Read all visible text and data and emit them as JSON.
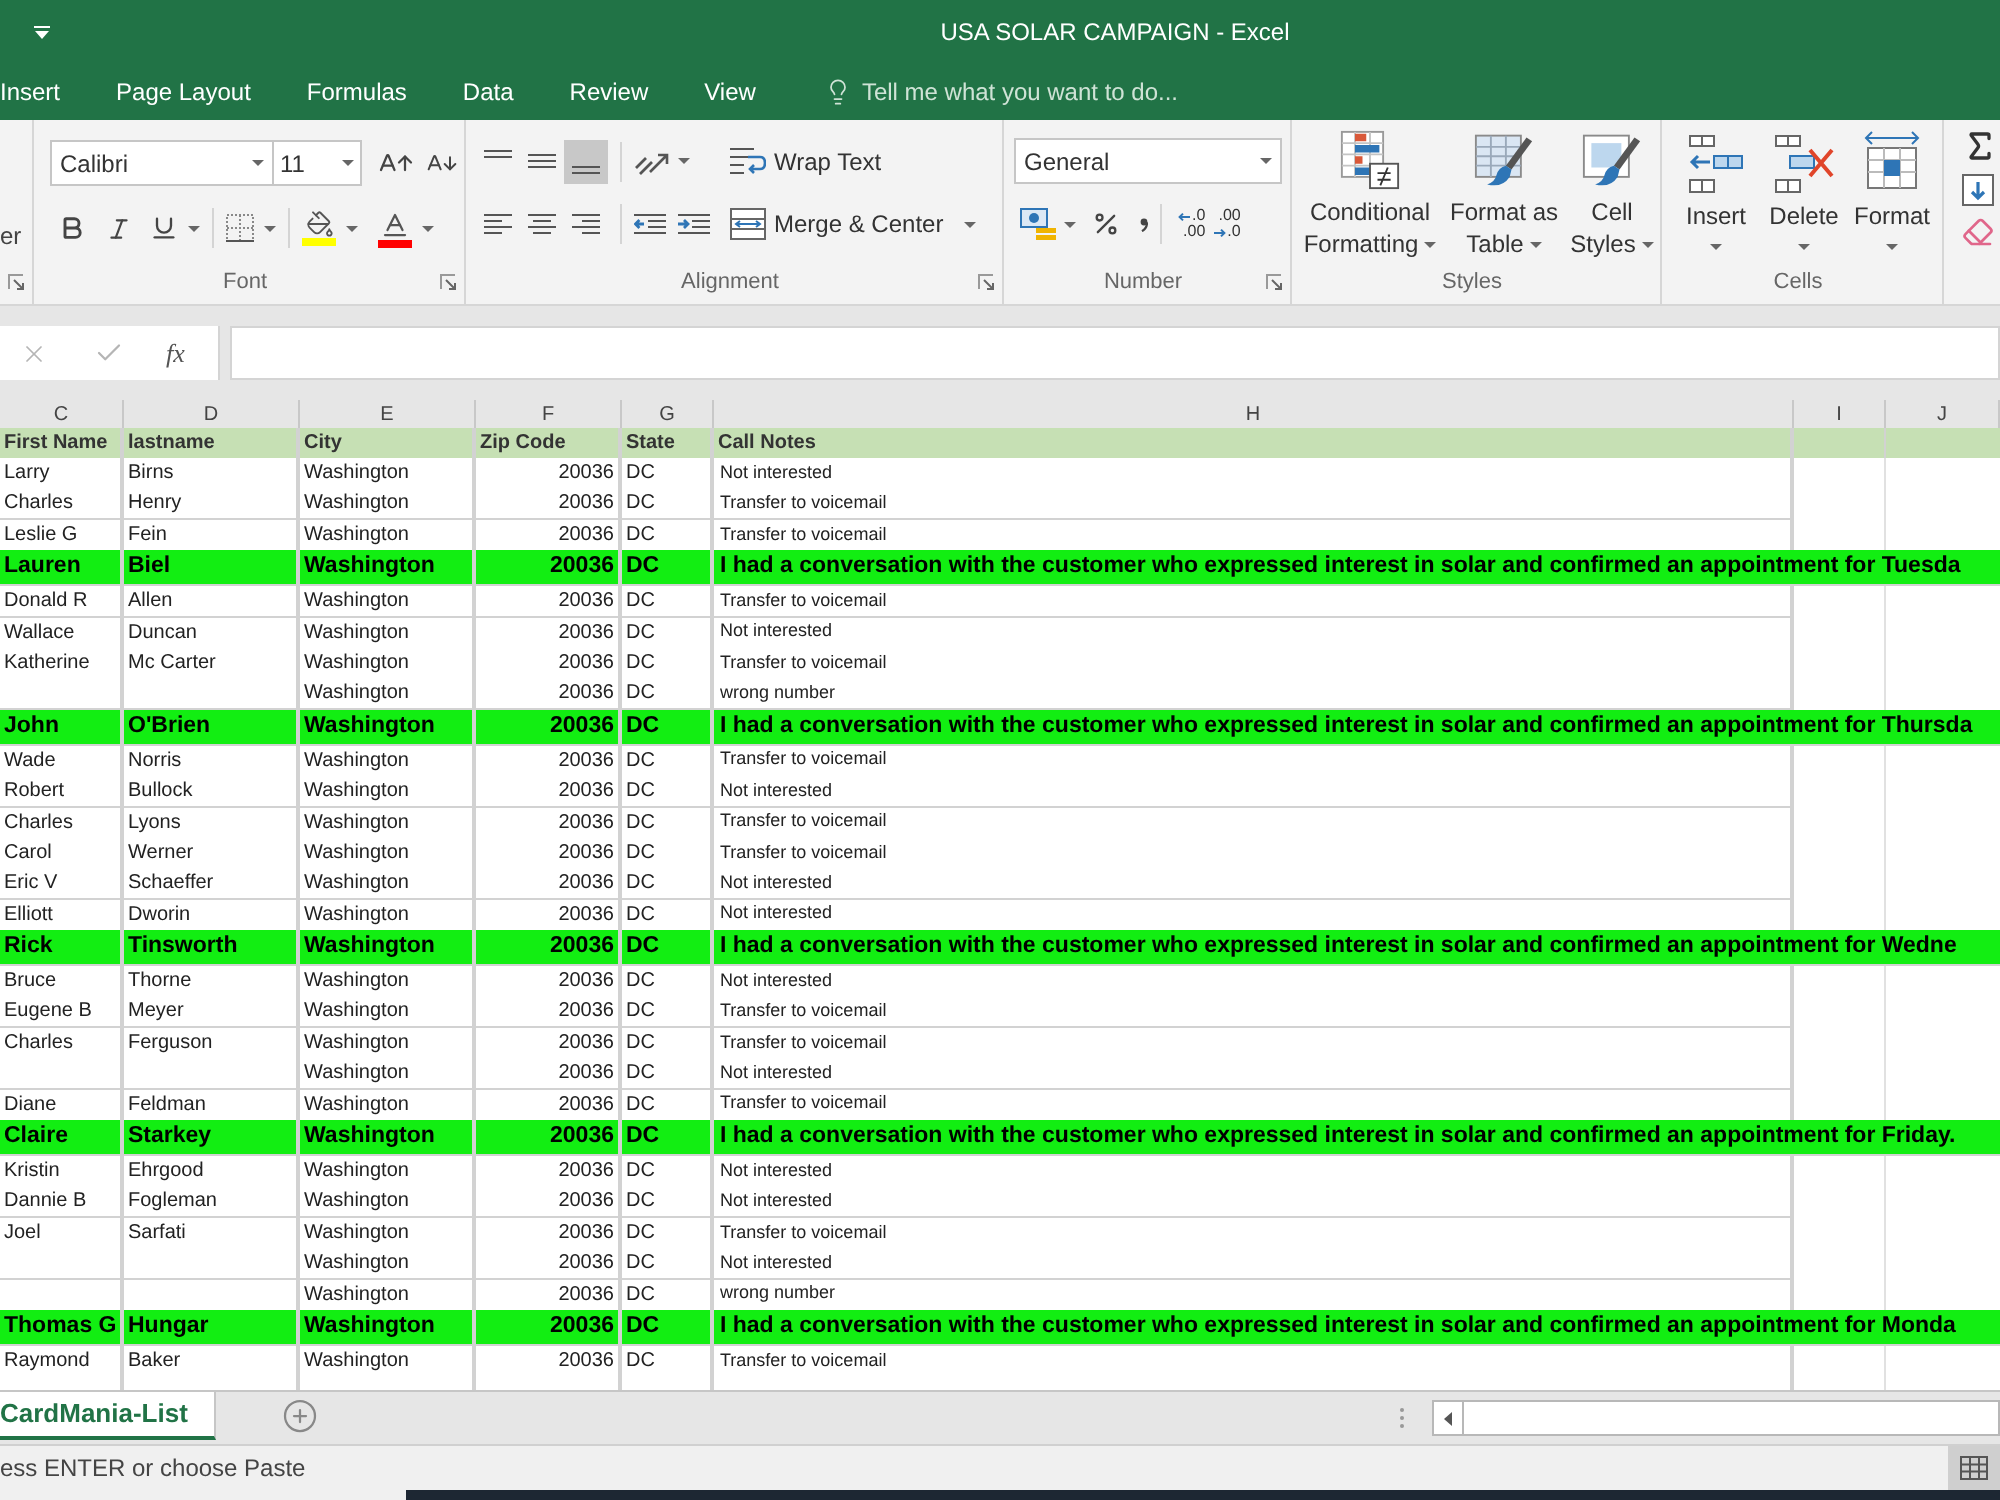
{
  "window": {
    "title": "USA SOLAR CAMPAIGN - Excel"
  },
  "ribbon_tabs": [
    {
      "label": "Insert",
      "selected": false
    },
    {
      "label": "Page Layout",
      "selected": false
    },
    {
      "label": "Formulas",
      "selected": false
    },
    {
      "label": "Data",
      "selected": false
    },
    {
      "label": "Review",
      "selected": false
    },
    {
      "label": "View",
      "selected": false
    }
  ],
  "tell_me": {
    "placeholder": "Tell me what you want to do..."
  },
  "ribbon": {
    "clipboard": {
      "command_fragment": "er"
    },
    "font": {
      "label": "Font",
      "font_name": "Calibri",
      "font_size": "11"
    },
    "alignment": {
      "label": "Alignment",
      "vertical_align": [
        {
          "kind": "top",
          "selected": false
        },
        {
          "kind": "middle",
          "selected": false
        },
        {
          "kind": "bottom",
          "selected": true
        }
      ],
      "wrap_text": "Wrap Text",
      "merge": "Merge & Center"
    },
    "number": {
      "label": "Number",
      "format": "General",
      "decimal_buttons": [
        {
          "kind": "increase",
          "upper": ".0",
          "lower": ".00"
        },
        {
          "kind": "decrease",
          "upper": ".00",
          "lower": ".0"
        }
      ]
    },
    "styles": {
      "label": "Styles",
      "buttons": [
        {
          "kind": "conditional_formatting",
          "lines": [
            "Conditional",
            "Formatting"
          ]
        },
        {
          "kind": "format_as_table",
          "lines": [
            "Format as",
            "Table"
          ]
        },
        {
          "kind": "cell_styles",
          "lines": [
            "Cell",
            "Styles"
          ]
        }
      ]
    },
    "cells": {
      "label": "Cells",
      "buttons": [
        {
          "kind": "insert",
          "label": "Insert"
        },
        {
          "kind": "delete",
          "label": "Delete"
        },
        {
          "kind": "format",
          "label": "Format"
        }
      ]
    }
  },
  "formula_bar": {
    "function_label": "fx"
  },
  "sheet": {
    "column_letters": [
      "C",
      "D",
      "E",
      "F",
      "G",
      "H",
      "I",
      "J"
    ],
    "headers": [
      "First Name",
      "lastname",
      "City",
      "Zip Code",
      "State",
      "Call Notes"
    ],
    "rows": [
      {
        "first_name": "Larry",
        "last_name": "Birns",
        "city": "Washington",
        "zip": "20036",
        "state": "DC",
        "call_notes": "Not interested",
        "highlighted": false
      },
      {
        "first_name": "Charles",
        "last_name": "Henry",
        "city": "Washington",
        "zip": "20036",
        "state": "DC",
        "call_notes": "Transfer to voicemail",
        "highlighted": false
      },
      {
        "first_name": "Leslie G",
        "last_name": "Fein",
        "city": "Washington",
        "zip": "20036",
        "state": "DC",
        "call_notes": "Transfer to voicemail",
        "highlighted": false
      },
      {
        "first_name": "Lauren",
        "last_name": "Biel",
        "city": "Washington",
        "zip": "20036",
        "state": "DC",
        "call_notes": "I had a conversation with the customer who expressed interest in solar and confirmed an appointment for Tuesda",
        "highlighted": true
      },
      {
        "first_name": "Donald R",
        "last_name": "Allen",
        "city": "Washington",
        "zip": "20036",
        "state": "DC",
        "call_notes": "Transfer to voicemail",
        "highlighted": false
      },
      {
        "first_name": "Wallace",
        "last_name": "Duncan",
        "city": "Washington",
        "zip": "20036",
        "state": "DC",
        "call_notes": "Not interested",
        "highlighted": false
      },
      {
        "first_name": "Katherine",
        "last_name": "Mc Carter",
        "city": "Washington",
        "zip": "20036",
        "state": "DC",
        "call_notes": "Transfer to voicemail",
        "highlighted": false
      },
      {
        "city": "Washington",
        "zip": "20036",
        "state": "DC",
        "call_notes": "wrong number",
        "highlighted": false
      },
      {
        "first_name": "John",
        "last_name": "O'Brien",
        "city": "Washington",
        "zip": "20036",
        "state": "DC",
        "call_notes": "I had a conversation with the customer who expressed interest in solar and confirmed an appointment for Thursda",
        "highlighted": true
      },
      {
        "first_name": "Wade",
        "last_name": "Norris",
        "city": "Washington",
        "zip": "20036",
        "state": "DC",
        "call_notes": "Transfer to voicemail",
        "highlighted": false
      },
      {
        "first_name": "Robert",
        "last_name": "Bullock",
        "city": "Washington",
        "zip": "20036",
        "state": "DC",
        "call_notes": "Not interested",
        "highlighted": false
      },
      {
        "first_name": "Charles",
        "last_name": "Lyons",
        "city": "Washington",
        "zip": "20036",
        "state": "DC",
        "call_notes": "Transfer to voicemail",
        "highlighted": false
      },
      {
        "first_name": "Carol",
        "last_name": "Werner",
        "city": "Washington",
        "zip": "20036",
        "state": "DC",
        "call_notes": "Transfer to voicemail",
        "highlighted": false
      },
      {
        "first_name": "Eric V",
        "last_name": "Schaeffer",
        "city": "Washington",
        "zip": "20036",
        "state": "DC",
        "call_notes": "Not interested",
        "highlighted": false
      },
      {
        "first_name": "Elliott",
        "last_name": "Dworin",
        "city": "Washington",
        "zip": "20036",
        "state": "DC",
        "call_notes": "Not interested",
        "highlighted": false
      },
      {
        "first_name": "Rick",
        "last_name": "Tinsworth",
        "city": "Washington",
        "zip": "20036",
        "state": "DC",
        "call_notes": "I had a conversation with the customer who expressed interest in solar and confirmed an appointment for Wedne",
        "highlighted": true
      },
      {
        "first_name": "Bruce",
        "last_name": "Thorne",
        "city": "Washington",
        "zip": "20036",
        "state": "DC",
        "call_notes": "Not interested",
        "highlighted": false
      },
      {
        "first_name": "Eugene B",
        "last_name": "Meyer",
        "city": "Washington",
        "zip": "20036",
        "state": "DC",
        "call_notes": "Transfer to voicemail",
        "highlighted": false
      },
      {
        "first_name": "Charles",
        "last_name": "Ferguson",
        "city": "Washington",
        "zip": "20036",
        "state": "DC",
        "call_notes": "Transfer to voicemail",
        "highlighted": false
      },
      {
        "city": "Washington",
        "zip": "20036",
        "state": "DC",
        "call_notes": "Not interested",
        "highlighted": false
      },
      {
        "first_name": "Diane",
        "last_name": "Feldman",
        "city": "Washington",
        "zip": "20036",
        "state": "DC",
        "call_notes": "Transfer to voicemail",
        "highlighted": false
      },
      {
        "first_name": "Claire",
        "last_name": "Starkey",
        "city": "Washington",
        "zip": "20036",
        "state": "DC",
        "call_notes": "I had a conversation with the customer who expressed interest in solar and confirmed an appointment for Friday.",
        "highlighted": true
      },
      {
        "first_name": "Kristin",
        "last_name": "Ehrgood",
        "city": "Washington",
        "zip": "20036",
        "state": "DC",
        "call_notes": "Not interested",
        "highlighted": false
      },
      {
        "first_name": "Dannie B",
        "last_name": "Fogleman",
        "city": "Washington",
        "zip": "20036",
        "state": "DC",
        "call_notes": "Not interested",
        "highlighted": false
      },
      {
        "first_name": "Joel",
        "last_name": "Sarfati",
        "city": "Washington",
        "zip": "20036",
        "state": "DC",
        "call_notes": "Transfer to voicemail",
        "highlighted": false
      },
      {
        "city": "Washington",
        "zip": "20036",
        "state": "DC",
        "call_notes": "Not interested",
        "highlighted": false
      },
      {
        "city": "Washington",
        "zip": "20036",
        "state": "DC",
        "call_notes": "wrong number",
        "highlighted": false
      },
      {
        "first_name": "Thomas G",
        "last_name": "Hungar",
        "city": "Washington",
        "zip": "20036",
        "state": "DC",
        "call_notes": "I had a conversation with the customer who expressed interest in solar and confirmed an appointment for Monda",
        "highlighted": true
      },
      {
        "first_name": "Raymond",
        "last_name": "Baker",
        "city": "Washington",
        "zip": "20036",
        "state": "DC",
        "call_notes": "Transfer to voicemail",
        "highlighted": false
      }
    ]
  },
  "sheet_tabs": [
    {
      "label": "CardMania-List",
      "selected": true
    }
  ],
  "status_bar": {
    "message": "ess ENTER or choose Paste",
    "view_buttons": [
      {
        "kind": "normal",
        "selected": true
      }
    ]
  }
}
